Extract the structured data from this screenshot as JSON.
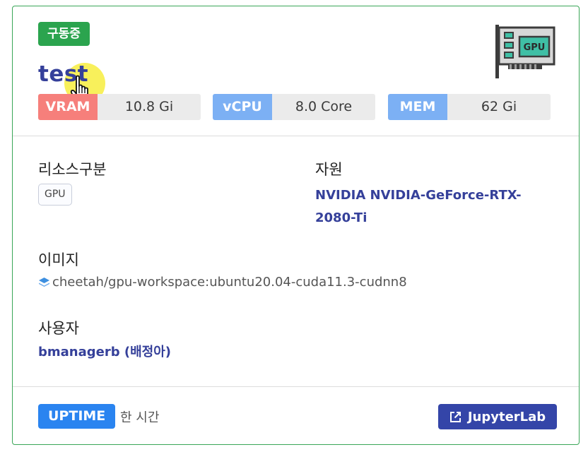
{
  "card": {
    "status": "구동중",
    "title": "test",
    "metrics": [
      {
        "label": "VRAM",
        "value": "10.8 Gi",
        "color": "#f67f7b"
      },
      {
        "label": "vCPU",
        "value": "8.0 Core",
        "color": "#7cb0f4"
      },
      {
        "label": "MEM",
        "value": "62 Gi",
        "color": "#7cb0f4"
      }
    ],
    "icon": "gpu-card-icon"
  },
  "details": {
    "resource_type_label": "리소스구분",
    "resource_type_value": "GPU",
    "resource_label": "자원",
    "resource_value": "NVIDIA NVIDIA-GeForce-RTX-2080-Ti",
    "image_label": "이미지",
    "image_value": "cheetah/gpu-workspace:ubuntu20.04-cuda11.3-cudnn8",
    "user_label": "사용자",
    "user_value": "bmanagerb (배정아)"
  },
  "footer": {
    "uptime_label": "UPTIME",
    "uptime_value": "한 시간",
    "jupyter_label": "JupyterLab"
  },
  "colors": {
    "border": "#3aa657",
    "status": "#2ba44e",
    "accent_text": "#35409a",
    "uptime": "#2a84f0",
    "button": "#3445a8"
  }
}
